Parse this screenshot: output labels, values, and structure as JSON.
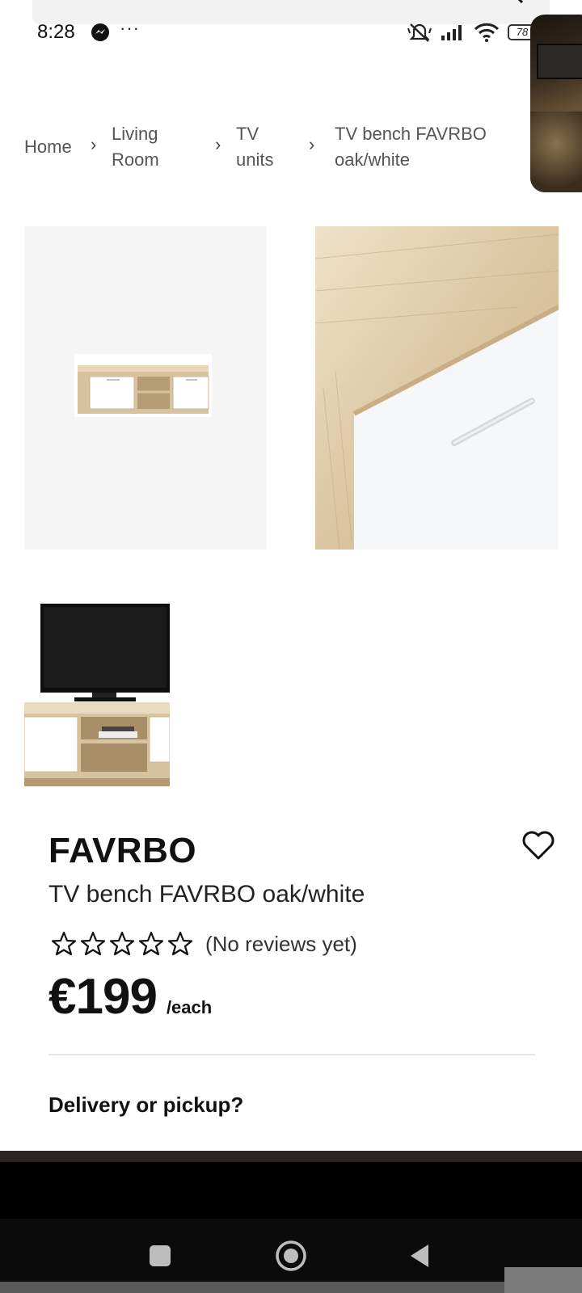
{
  "status_bar": {
    "time": "8:28",
    "overflow": "···",
    "battery": "78"
  },
  "breadcrumb": {
    "items": [
      {
        "label": "Home"
      },
      {
        "label_line1": "Living",
        "label_line2": "Room"
      },
      {
        "label_line1": "TV",
        "label_line2": "units"
      },
      {
        "label_line1": "TV bench FAVRBO",
        "label_line2": "oak/white"
      }
    ],
    "separator": "›"
  },
  "product": {
    "brand": "FAVRBO",
    "description": "TV bench FAVRBO oak/white",
    "rating": 0,
    "rating_max": 5,
    "reviews_text": "(No reviews yet)",
    "price": "€199",
    "price_unit": "/each",
    "delivery_label": "Delivery or pickup?"
  },
  "icons": {
    "favorite": "heart-outline-icon",
    "star": "star-outline-icon",
    "messenger": "messenger-icon",
    "search": "search-icon"
  },
  "colors": {
    "text": "#111111",
    "muted": "#555555",
    "image_bg": "#f5f5f5",
    "nav_bg": "#0b0b0b"
  }
}
